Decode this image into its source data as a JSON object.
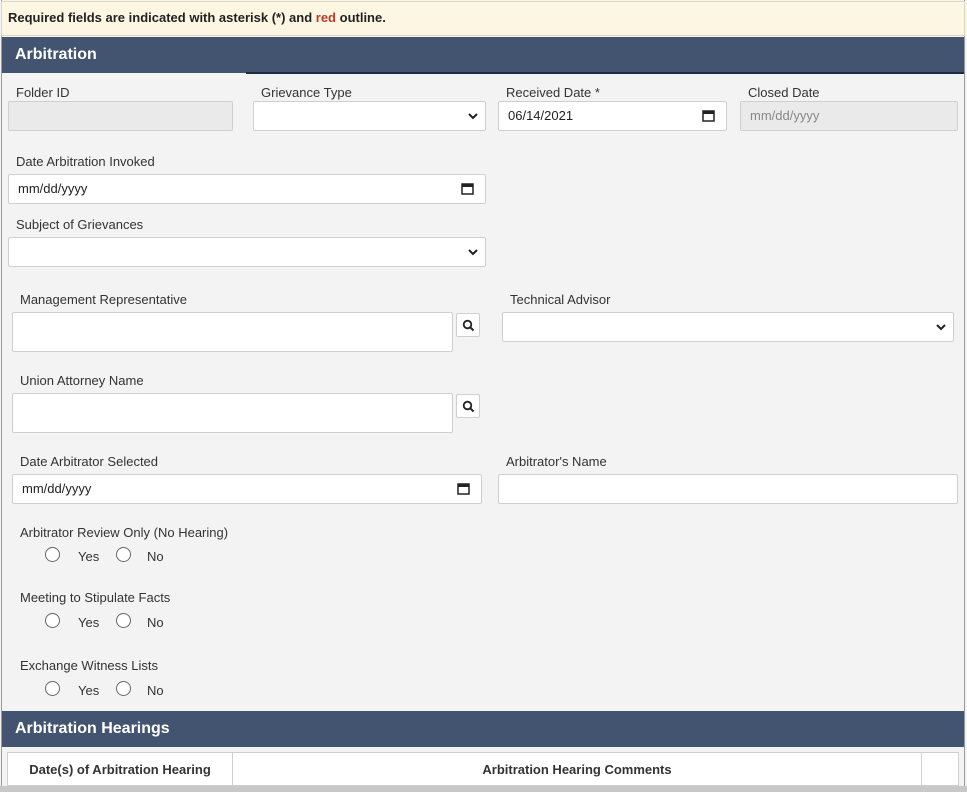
{
  "notice": {
    "prefix": "Required fields are indicated with asterisk (*) and",
    "red_word": "red",
    "suffix": "outline."
  },
  "arbitration": {
    "title": "Arbitration",
    "folder_id": {
      "label": "Folder ID",
      "value": ""
    },
    "grievance_type": {
      "label": "Grievance Type",
      "value": ""
    },
    "received_date": {
      "label": "Received Date *",
      "value": "06/14/2021"
    },
    "closed_date": {
      "label": "Closed Date",
      "placeholder": "mm/dd/yyyy"
    },
    "date_invoked": {
      "label": "Date Arbitration Invoked",
      "placeholder": "mm/dd/yyyy"
    },
    "subject": {
      "label": "Subject of Grievances",
      "value": ""
    },
    "management_rep": {
      "label": "Management Representative",
      "value": ""
    },
    "technical_advisor": {
      "label": "Technical Advisor",
      "value": ""
    },
    "union_attorney": {
      "label": "Union Attorney Name",
      "value": ""
    },
    "date_arbitrator_selected": {
      "label": "Date Arbitrator Selected",
      "placeholder": "mm/dd/yyyy"
    },
    "arbitrator_name": {
      "label": "Arbitrator's Name",
      "value": ""
    },
    "review_only": {
      "label": "Arbitrator Review Only (No Hearing)",
      "yes": "Yes",
      "no": "No"
    },
    "stipulate": {
      "label": "Meeting to Stipulate Facts",
      "yes": "Yes",
      "no": "No"
    },
    "witness": {
      "label": "Exchange Witness Lists",
      "yes": "Yes",
      "no": "No"
    }
  },
  "hearings": {
    "title": "Arbitration Hearings",
    "columns": [
      "Date(s) of Arbitration Hearing",
      "Arbitration Hearing Comments"
    ]
  },
  "icons": {
    "calendar": "calendar-icon",
    "chevron": "chevron-down-icon",
    "search": "search-icon"
  }
}
